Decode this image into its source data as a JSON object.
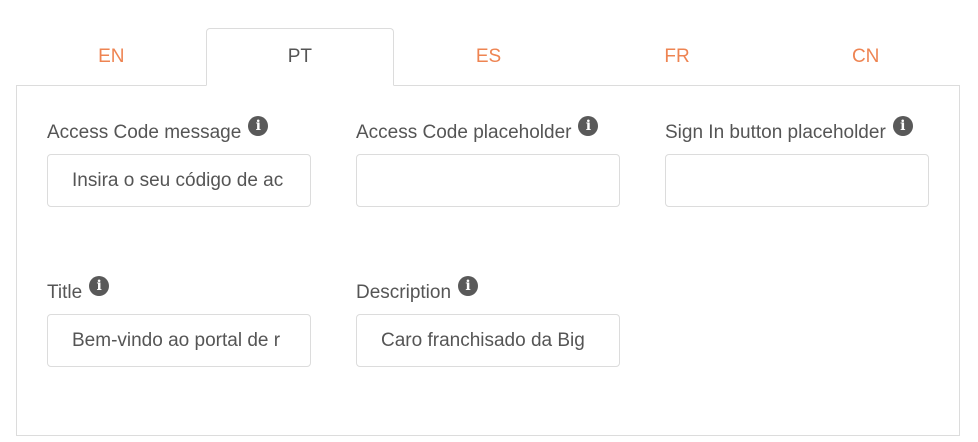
{
  "tabs": [
    {
      "label": "EN",
      "active": false
    },
    {
      "label": "PT",
      "active": true
    },
    {
      "label": "ES",
      "active": false
    },
    {
      "label": "FR",
      "active": false
    },
    {
      "label": "CN",
      "active": false
    }
  ],
  "fields": {
    "access_code_message": {
      "label": "Access Code message",
      "value": "Insira o seu código de ac"
    },
    "access_code_placeholder": {
      "label": "Access Code placeholder",
      "value": ""
    },
    "sign_in_button_placeholder": {
      "label": "Sign In button placeholder",
      "value": ""
    },
    "title": {
      "label": "Title",
      "value": "Bem-vindo ao portal de r"
    },
    "description": {
      "label": "Description",
      "value": "Caro franchisado da Big "
    }
  },
  "icons": {
    "info": "i"
  },
  "colors": {
    "tab_inactive": "#ee8452",
    "text": "#555555",
    "border": "#dcdcdc",
    "info_icon_bg": "#595959"
  }
}
